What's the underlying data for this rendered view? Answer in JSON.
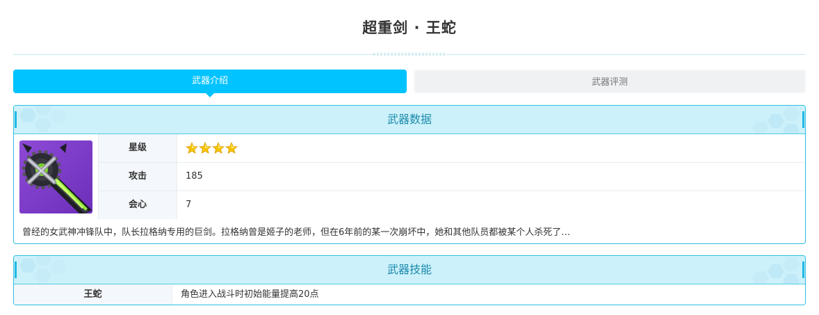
{
  "page": {
    "title": "超重剑 · 王蛇"
  },
  "tabs": [
    {
      "label": "武器介绍",
      "active": true
    },
    {
      "label": "武器评测",
      "active": false
    }
  ],
  "weapon_data": {
    "header": "武器数据",
    "image_icon": "weapon-greatsword-image",
    "stats": [
      {
        "label": "星级",
        "value": "",
        "stars": 4
      },
      {
        "label": "攻击",
        "value": "185"
      },
      {
        "label": "会心",
        "value": "7"
      }
    ],
    "description": "曾经的女武神冲锋队中，队长拉格纳专用的巨剑。拉格纳曾是姬子的老师，但在6年前的某一次崩坏中，她和其他队员都被某个人杀死了…"
  },
  "weapon_skill": {
    "header": "武器技能",
    "name": "王蛇",
    "description": "角色进入战斗时初始能量提高20点"
  },
  "colors": {
    "accent": "#00c3ff",
    "panel_border": "#2cc0df",
    "header_bg": "#cdf1fb",
    "header_text": "#1a8aab",
    "star": "#f5c400"
  }
}
